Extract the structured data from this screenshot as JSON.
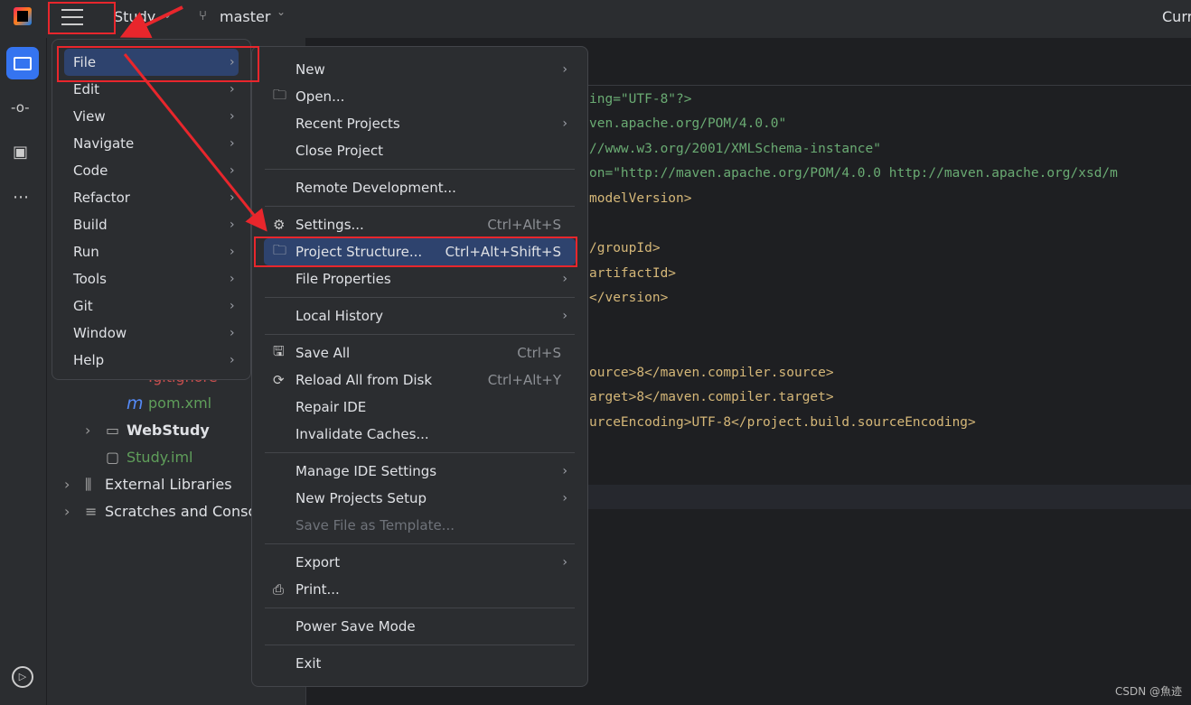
{
  "topbar": {
    "project": "Study",
    "branch": "master",
    "right_text": "Curr"
  },
  "tree": {
    "gitignore": ".gitignore",
    "pom": "pom.xml",
    "webstudy": "WebStudy",
    "iml": "Study.iml",
    "ext": "External Libraries",
    "scratch": "Scratches and Consoles"
  },
  "code": [
    {
      "t": "ing=\"UTF-8\"?>",
      "c": "str"
    },
    {
      "t": "ven.apache.org/POM/4.0.0\"",
      "c": "str"
    },
    {
      "t": "//www.w3.org/2001/XMLSchema-instance\"",
      "c": "str"
    },
    {
      "t": "on=\"http://maven.apache.org/POM/4.0.0 http://maven.apache.org/xsd/m",
      "c": "str"
    },
    {
      "t": "modelVersion>",
      "c": "tag"
    },
    {
      "t": "",
      "c": "tag"
    },
    {
      "t": "/groupId>",
      "c": "tag"
    },
    {
      "t": "artifactId>",
      "c": "tag"
    },
    {
      "t": "</version>",
      "c": "tag"
    },
    {
      "t": "",
      "c": "tag"
    },
    {
      "t": "",
      "c": "tag"
    },
    {
      "t": "ource>8</maven.compiler.source>",
      "c": "tag"
    },
    {
      "t": "arget>8</maven.compiler.target>",
      "c": "tag"
    },
    {
      "t": "urceEncoding>UTF-8</project.build.sourceEncoding>",
      "c": "tag"
    }
  ],
  "main_menu": [
    "File",
    "Edit",
    "View",
    "Navigate",
    "Code",
    "Refactor",
    "Build",
    "Run",
    "Tools",
    "Git",
    "Window",
    "Help"
  ],
  "file_menu": [
    {
      "label": "New",
      "arrow": true
    },
    {
      "label": "Open...",
      "icon": "folder-icon"
    },
    {
      "label": "Recent Projects",
      "arrow": true
    },
    {
      "label": "Close Project"
    },
    {
      "sep": true
    },
    {
      "label": "Remote Development..."
    },
    {
      "sep": true
    },
    {
      "label": "Settings...",
      "shortcut": "Ctrl+Alt+S",
      "icon": "gear-icon"
    },
    {
      "label": "Project Structure...",
      "shortcut": "Ctrl+Alt+Shift+S",
      "icon": "project-structure-icon",
      "selected": true
    },
    {
      "label": "File Properties",
      "arrow": true
    },
    {
      "sep": true
    },
    {
      "label": "Local History",
      "arrow": true
    },
    {
      "sep": true
    },
    {
      "label": "Save All",
      "shortcut": "Ctrl+S",
      "icon": "save-icon"
    },
    {
      "label": "Reload All from Disk",
      "shortcut": "Ctrl+Alt+Y",
      "icon": "reload-icon"
    },
    {
      "label": "Repair IDE"
    },
    {
      "label": "Invalidate Caches..."
    },
    {
      "sep": true
    },
    {
      "label": "Manage IDE Settings",
      "arrow": true
    },
    {
      "label": "New Projects Setup",
      "arrow": true
    },
    {
      "label": "Save File as Template...",
      "disabled": true
    },
    {
      "sep": true
    },
    {
      "label": "Export",
      "arrow": true
    },
    {
      "label": "Print...",
      "icon": "print-icon"
    },
    {
      "sep": true
    },
    {
      "label": "Power Save Mode"
    },
    {
      "sep": true
    },
    {
      "label": "Exit"
    }
  ],
  "watermark": "CSDN @魚迹",
  "colors": {
    "accent": "#3574f0",
    "selection": "#2e436e",
    "annotation": "#e8262c"
  }
}
